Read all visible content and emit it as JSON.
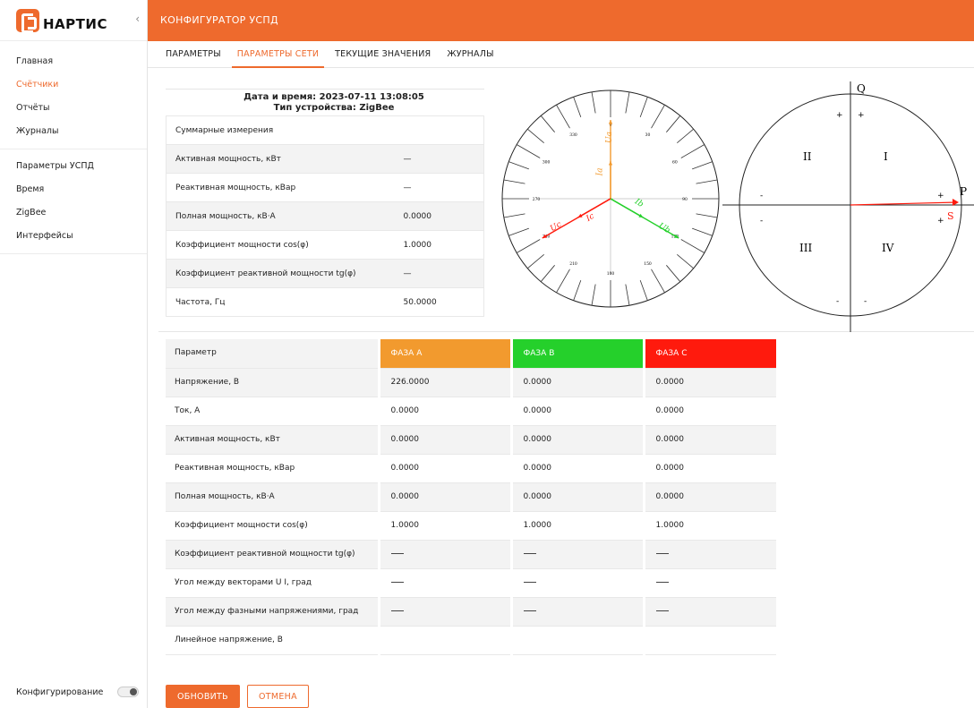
{
  "sidebar": {
    "logo_text": "НАРТИС",
    "collapse_icon": "chevron-left-icon",
    "nav_main": [
      {
        "label": "Главная",
        "active": false
      },
      {
        "label": "Счётчики",
        "active": true
      },
      {
        "label": "Отчёты",
        "active": false
      },
      {
        "label": "Журналы",
        "active": false
      }
    ],
    "nav_settings": [
      {
        "label": "Параметры УСПД"
      },
      {
        "label": "Время"
      },
      {
        "label": "ZigBee"
      },
      {
        "label": "Интерфейсы"
      }
    ],
    "config_label": "Конфигурирование"
  },
  "header": {
    "title": "КОНФИГУРАТОР УСПД"
  },
  "tabs": [
    {
      "label": "ПАРАМЕТРЫ",
      "active": false
    },
    {
      "label": "ПАРАМЕТРЫ СЕТИ",
      "active": true
    },
    {
      "label": "ТЕКУЩИЕ ЗНАЧЕНИЯ",
      "active": false
    },
    {
      "label": "ЖУРНАЛЫ",
      "active": false
    }
  ],
  "summary": {
    "datetime": "Дата и время: 2023-07-11 13:08:05",
    "device_type": "Тип устройства: ZigBee",
    "rows": [
      {
        "label": "Суммарные измерения",
        "value": ""
      },
      {
        "label": "Активная мощность, кВт",
        "value": "—"
      },
      {
        "label": "Реактивная мощность, кВар",
        "value": "—"
      },
      {
        "label": "Полная мощность, кВ·А",
        "value": "0.0000"
      },
      {
        "label": "Коэффициент мощности cos(φ)",
        "value": "1.0000"
      },
      {
        "label": "Коэффициент реактивной мощности tg(φ)",
        "value": "—"
      },
      {
        "label": "Частота, Гц",
        "value": "50.0000"
      }
    ]
  },
  "vector_diagram": {
    "angle_labels": [
      "0",
      "30",
      "60",
      "90",
      "120",
      "150",
      "180",
      "210",
      "240",
      "270",
      "300",
      "330"
    ],
    "vectors": [
      {
        "label": "Ua",
        "angle_deg": 0,
        "color": "#f29a2e"
      },
      {
        "label": "Ia",
        "angle_deg": 0,
        "color": "#f29a2e"
      },
      {
        "label": "Ub",
        "angle_deg": 120,
        "color": "#25d02b"
      },
      {
        "label": "Ib",
        "angle_deg": 120,
        "color": "#25d02b"
      },
      {
        "label": "Uc",
        "angle_deg": 240,
        "color": "#ff1a0d"
      },
      {
        "label": "Ic",
        "angle_deg": 240,
        "color": "#ff1a0d"
      }
    ]
  },
  "power_diagram": {
    "axis_q": "Q",
    "axis_p": "P",
    "vector_s": "S",
    "quadrants": [
      "I",
      "II",
      "III",
      "IV"
    ],
    "signs": [
      "+",
      "+",
      "+",
      "+",
      "-",
      "-",
      "-",
      "-"
    ]
  },
  "phase_table": {
    "header": {
      "param": "Параметр",
      "a": "ФАЗА А",
      "b": "ФАЗА B",
      "c": "ФАЗА С"
    },
    "rows": [
      {
        "label": "Напряжение, В",
        "a": "226.0000",
        "b": "0.0000",
        "c": "0.0000"
      },
      {
        "label": "Ток, А",
        "a": "0.0000",
        "b": "0.0000",
        "c": "0.0000"
      },
      {
        "label": "Активная мощность, кВт",
        "a": "0.0000",
        "b": "0.0000",
        "c": "0.0000"
      },
      {
        "label": "Реактивная мощность, кВар",
        "a": "0.0000",
        "b": "0.0000",
        "c": "0.0000"
      },
      {
        "label": "Полная мощность, кВ·А",
        "a": "0.0000",
        "b": "0.0000",
        "c": "0.0000"
      },
      {
        "label": "Коэффициент мощности cos(φ)",
        "a": "1.0000",
        "b": "1.0000",
        "c": "1.0000"
      },
      {
        "label": "Коэффициент реактивной мощности tg(φ)",
        "a": "",
        "b": "",
        "c": ""
      },
      {
        "label": "Угол между векторами U I, град",
        "a": "",
        "b": "",
        "c": ""
      },
      {
        "label": "Угол между фазными напряжениями, град",
        "a": "",
        "b": "",
        "c": ""
      },
      {
        "label": "Линейное напряжение, В",
        "a": "",
        "b": "",
        "c": ""
      }
    ]
  },
  "buttons": {
    "refresh": "ОБНОВИТЬ",
    "cancel": "ОТМЕНА"
  },
  "colors": {
    "accent": "#ee6a2d",
    "phase_a": "#f29a2e",
    "phase_b": "#25d02b",
    "phase_c": "#ff1a0d"
  }
}
